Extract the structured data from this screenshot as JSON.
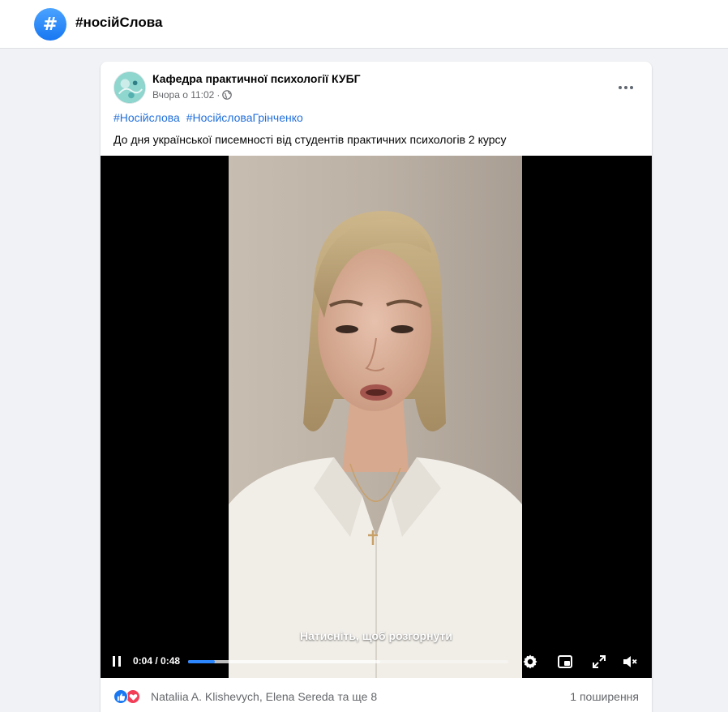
{
  "header": {
    "hash_symbol": "#",
    "title": "#носійСлова"
  },
  "post": {
    "page_name": "Кафедра практичної психології КУБГ",
    "time": "Вчора о 11:02",
    "separator": "·",
    "hashtags": [
      "#Носійслова",
      "#НосійсловаГрінченко"
    ],
    "text": "До дня української писемності від студентів практичних психологів 2 курсу"
  },
  "video": {
    "tap_hint": "Натисніть, щоб розгорнути",
    "time": "0:04 / 0:48",
    "progress_played": 0.083,
    "progress_buffered": 0.6,
    "icons": [
      "pause-icon",
      "settings-icon",
      "picture-in-picture-icon",
      "fullscreen-icon",
      "volume-muted-icon"
    ]
  },
  "footer": {
    "reactions": [
      "like",
      "love"
    ],
    "reactors": "Nataliia A. Klishevych, Elena Sereda та ще 8",
    "shares": "1 поширення"
  },
  "colors": {
    "link": "#216fdb",
    "accent": "#1877f2",
    "love": "#f33e58",
    "progress": "#2d88ff"
  }
}
